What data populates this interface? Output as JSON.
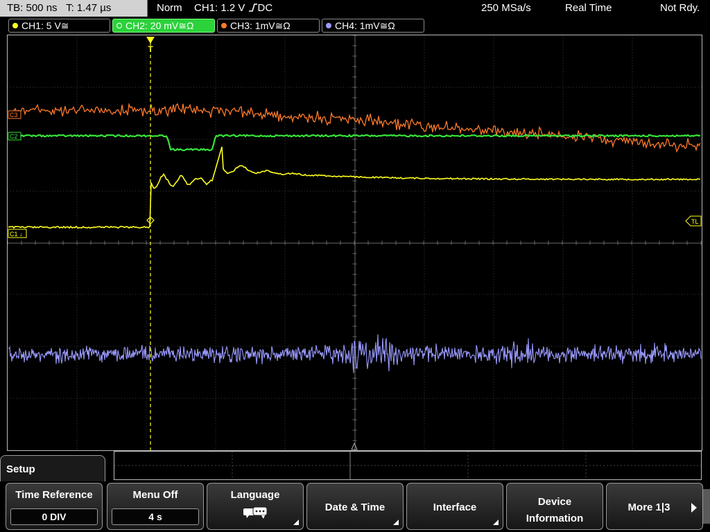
{
  "topbar": {
    "tb": "TB: 500 ns",
    "t": "T: 1.47 µs",
    "mode": "Norm",
    "trigger": "CH1: 1.2 V",
    "trigger_suffix": "DC",
    "samplerate": "250 MSa/s",
    "acquisition": "Real Time",
    "status": "Not Rdy."
  },
  "channels": [
    {
      "label": "CH1: 5 V≅",
      "color": "#ffff1e"
    },
    {
      "label": "CH2: 20 mV≅Ω",
      "color": "#36e43a",
      "active": true
    },
    {
      "label": "CH3: 1mV≅Ω",
      "color": "#ff7a2a"
    },
    {
      "label": "CH4: 1mV≅Ω",
      "color": "#9a9aff"
    }
  ],
  "scope": {
    "markers": {
      "ch1_marker": "C1",
      "ch2_marker": "C2",
      "ch3_marker": "C3",
      "trigger_level": "TL",
      "trigger_pos": "T"
    }
  },
  "menu": {
    "title": "Setup",
    "softkeys": [
      {
        "label": "Time Reference",
        "value": "0 DIV"
      },
      {
        "label": "Menu Off",
        "value": "4 s"
      },
      {
        "label": "Language"
      },
      {
        "label": "Date & Time"
      },
      {
        "label": "Interface"
      },
      {
        "label1": "Device",
        "label2": "Information"
      },
      {
        "label": "More 1|3"
      }
    ]
  },
  "icons": {
    "language": "speech-bubble-icon",
    "more": "arrow-right-icon"
  }
}
